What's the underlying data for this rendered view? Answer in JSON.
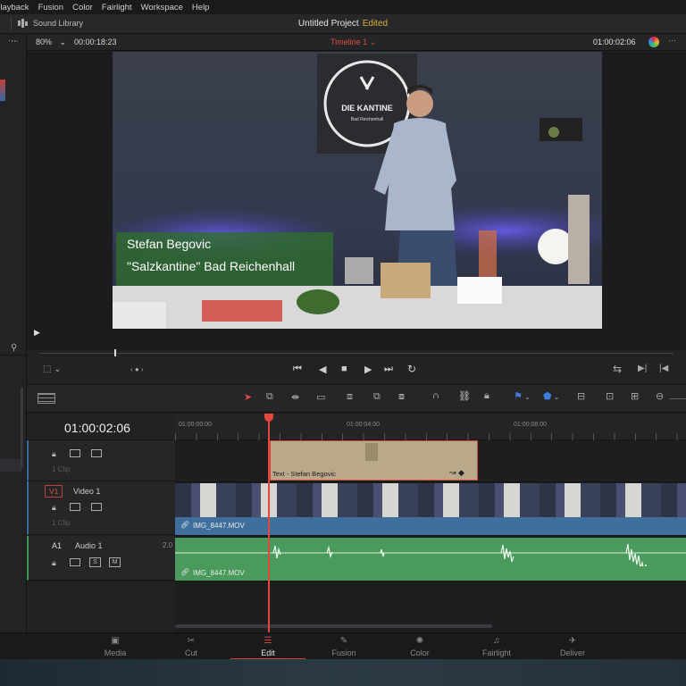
{
  "menu": [
    "Playback",
    "Fusion",
    "Color",
    "Fairlight",
    "Workspace",
    "Help"
  ],
  "titlebar": {
    "sound_library": "Sound Library",
    "project_title": "Untitled Project",
    "status": "Edited"
  },
  "viewer": {
    "zoom": "80%",
    "source_timecode": "00:00:18:23",
    "timeline_name": "Timeline 1",
    "record_timecode": "01:00:02:06"
  },
  "overlay": {
    "line1": "Stefan Begovic",
    "line2": "\"Salzkantine\" Bad Reichenhall"
  },
  "sign": {
    "title": "DIE KANTINE",
    "sub": "Bad Reichenhall"
  },
  "timeline": {
    "current_timecode": "01:00:02:06",
    "ruler": [
      "01:00:00:00",
      "01:00:04:00",
      "01:00:08:00"
    ],
    "tracks": {
      "v2": {
        "clip_count": "1 Clip",
        "clip_name": "Text - Stefan Begovic"
      },
      "v1": {
        "id": "V1",
        "name": "Video 1",
        "clip_count": "1 Clip",
        "clip_name": "IMG_8447.MOV"
      },
      "a1": {
        "id": "A1",
        "name": "Audio 1",
        "channel": "2.0",
        "clip_name": "IMG_8447.MOV",
        "solo": "S",
        "mute": "M"
      }
    }
  },
  "pages": [
    {
      "label": "Media",
      "icon": "media-icon"
    },
    {
      "label": "Cut",
      "icon": "cut-icon"
    },
    {
      "label": "Edit",
      "icon": "edit-icon"
    },
    {
      "label": "Fusion",
      "icon": "fusion-icon"
    },
    {
      "label": "Color",
      "icon": "color-icon"
    },
    {
      "label": "Fairlight",
      "icon": "fairlight-icon"
    },
    {
      "label": "Deliver",
      "icon": "deliver-icon"
    }
  ],
  "colors": {
    "playhead": "#e2473a",
    "video_clip": "#3f6f9c",
    "audio_clip": "#4a9a5e",
    "title_clip": "#b9a88a",
    "edited": "#d2b236"
  }
}
